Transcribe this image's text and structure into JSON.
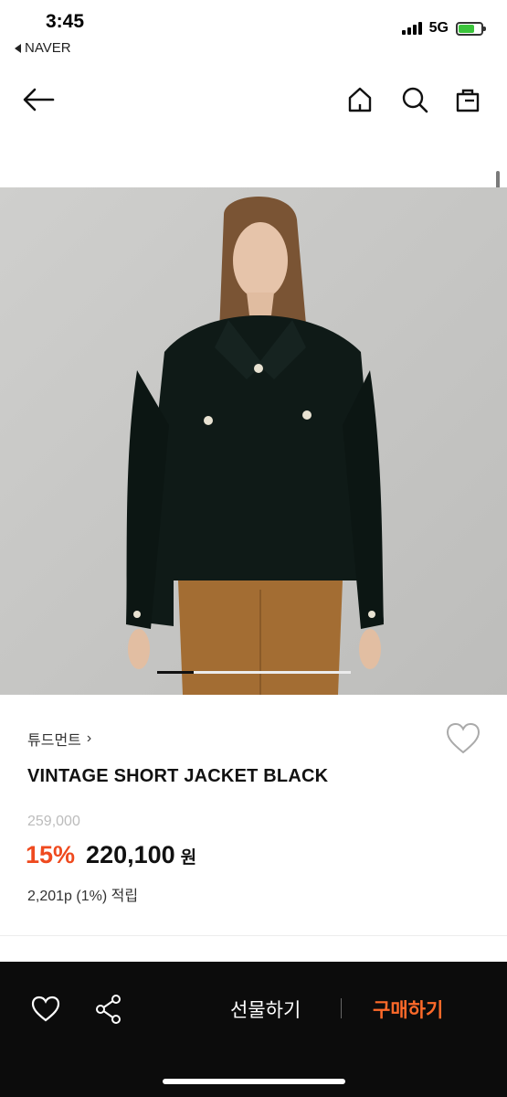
{
  "status_bar": {
    "time": "3:45",
    "back_app": "NAVER",
    "network": "5G",
    "battery_color": "#3bc43b"
  },
  "nav": {
    "back_icon": "arrow-left-icon",
    "home_icon": "home-icon",
    "search_icon": "search-icon",
    "bag_icon": "shopping-bag-icon"
  },
  "product": {
    "brand": "튜드먼트",
    "brand_chevron": "›",
    "title": "VINTAGE SHORT JACKET BLACK",
    "original_price": "259,000",
    "discount": "15%",
    "price": "220,100",
    "currency": "원",
    "points": "2,201p (1%) 적립",
    "image_index": 1,
    "image_count": 5
  },
  "bottom_bar": {
    "gift_label": "선물하기",
    "buy_label": "구매하기",
    "buy_color": "#ff6a2a"
  }
}
